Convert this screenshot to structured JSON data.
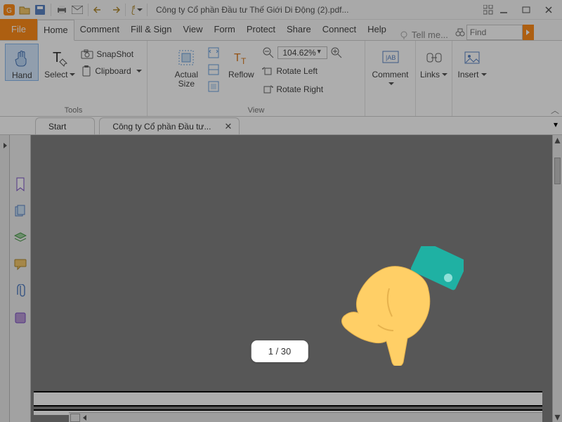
{
  "titlebar": {
    "doc_title": "Công ty Cổ phần Đầu tư Thế Giới Di Động (2).pdf..."
  },
  "menu": {
    "file": "File",
    "tabs": [
      "Home",
      "Comment",
      "Fill & Sign",
      "View",
      "Form",
      "Protect",
      "Share",
      "Connect",
      "Help"
    ],
    "tellme": "Tell me...",
    "find_placeholder": "Find"
  },
  "ribbon": {
    "tools": {
      "hand": "Hand",
      "select": "Select",
      "snapshot": "SnapShot",
      "clipboard": "Clipboard",
      "group": "Tools"
    },
    "view": {
      "actual_size": "Actual\nSize",
      "reflow": "Reflow",
      "zoom_value": "104.62%",
      "rotate_left": "Rotate Left",
      "rotate_right": "Rotate Right",
      "group": "View"
    },
    "comment": {
      "label": "Comment"
    },
    "links": {
      "label": "Links"
    },
    "insert": {
      "label": "Insert"
    }
  },
  "doctabs": {
    "start": "Start",
    "doc": "Công ty Cổ phần Đầu tư..."
  },
  "page_indicator": "1 / 30",
  "colors": {
    "accent": "#ff8c1a",
    "selection": "#d6e9ff"
  }
}
